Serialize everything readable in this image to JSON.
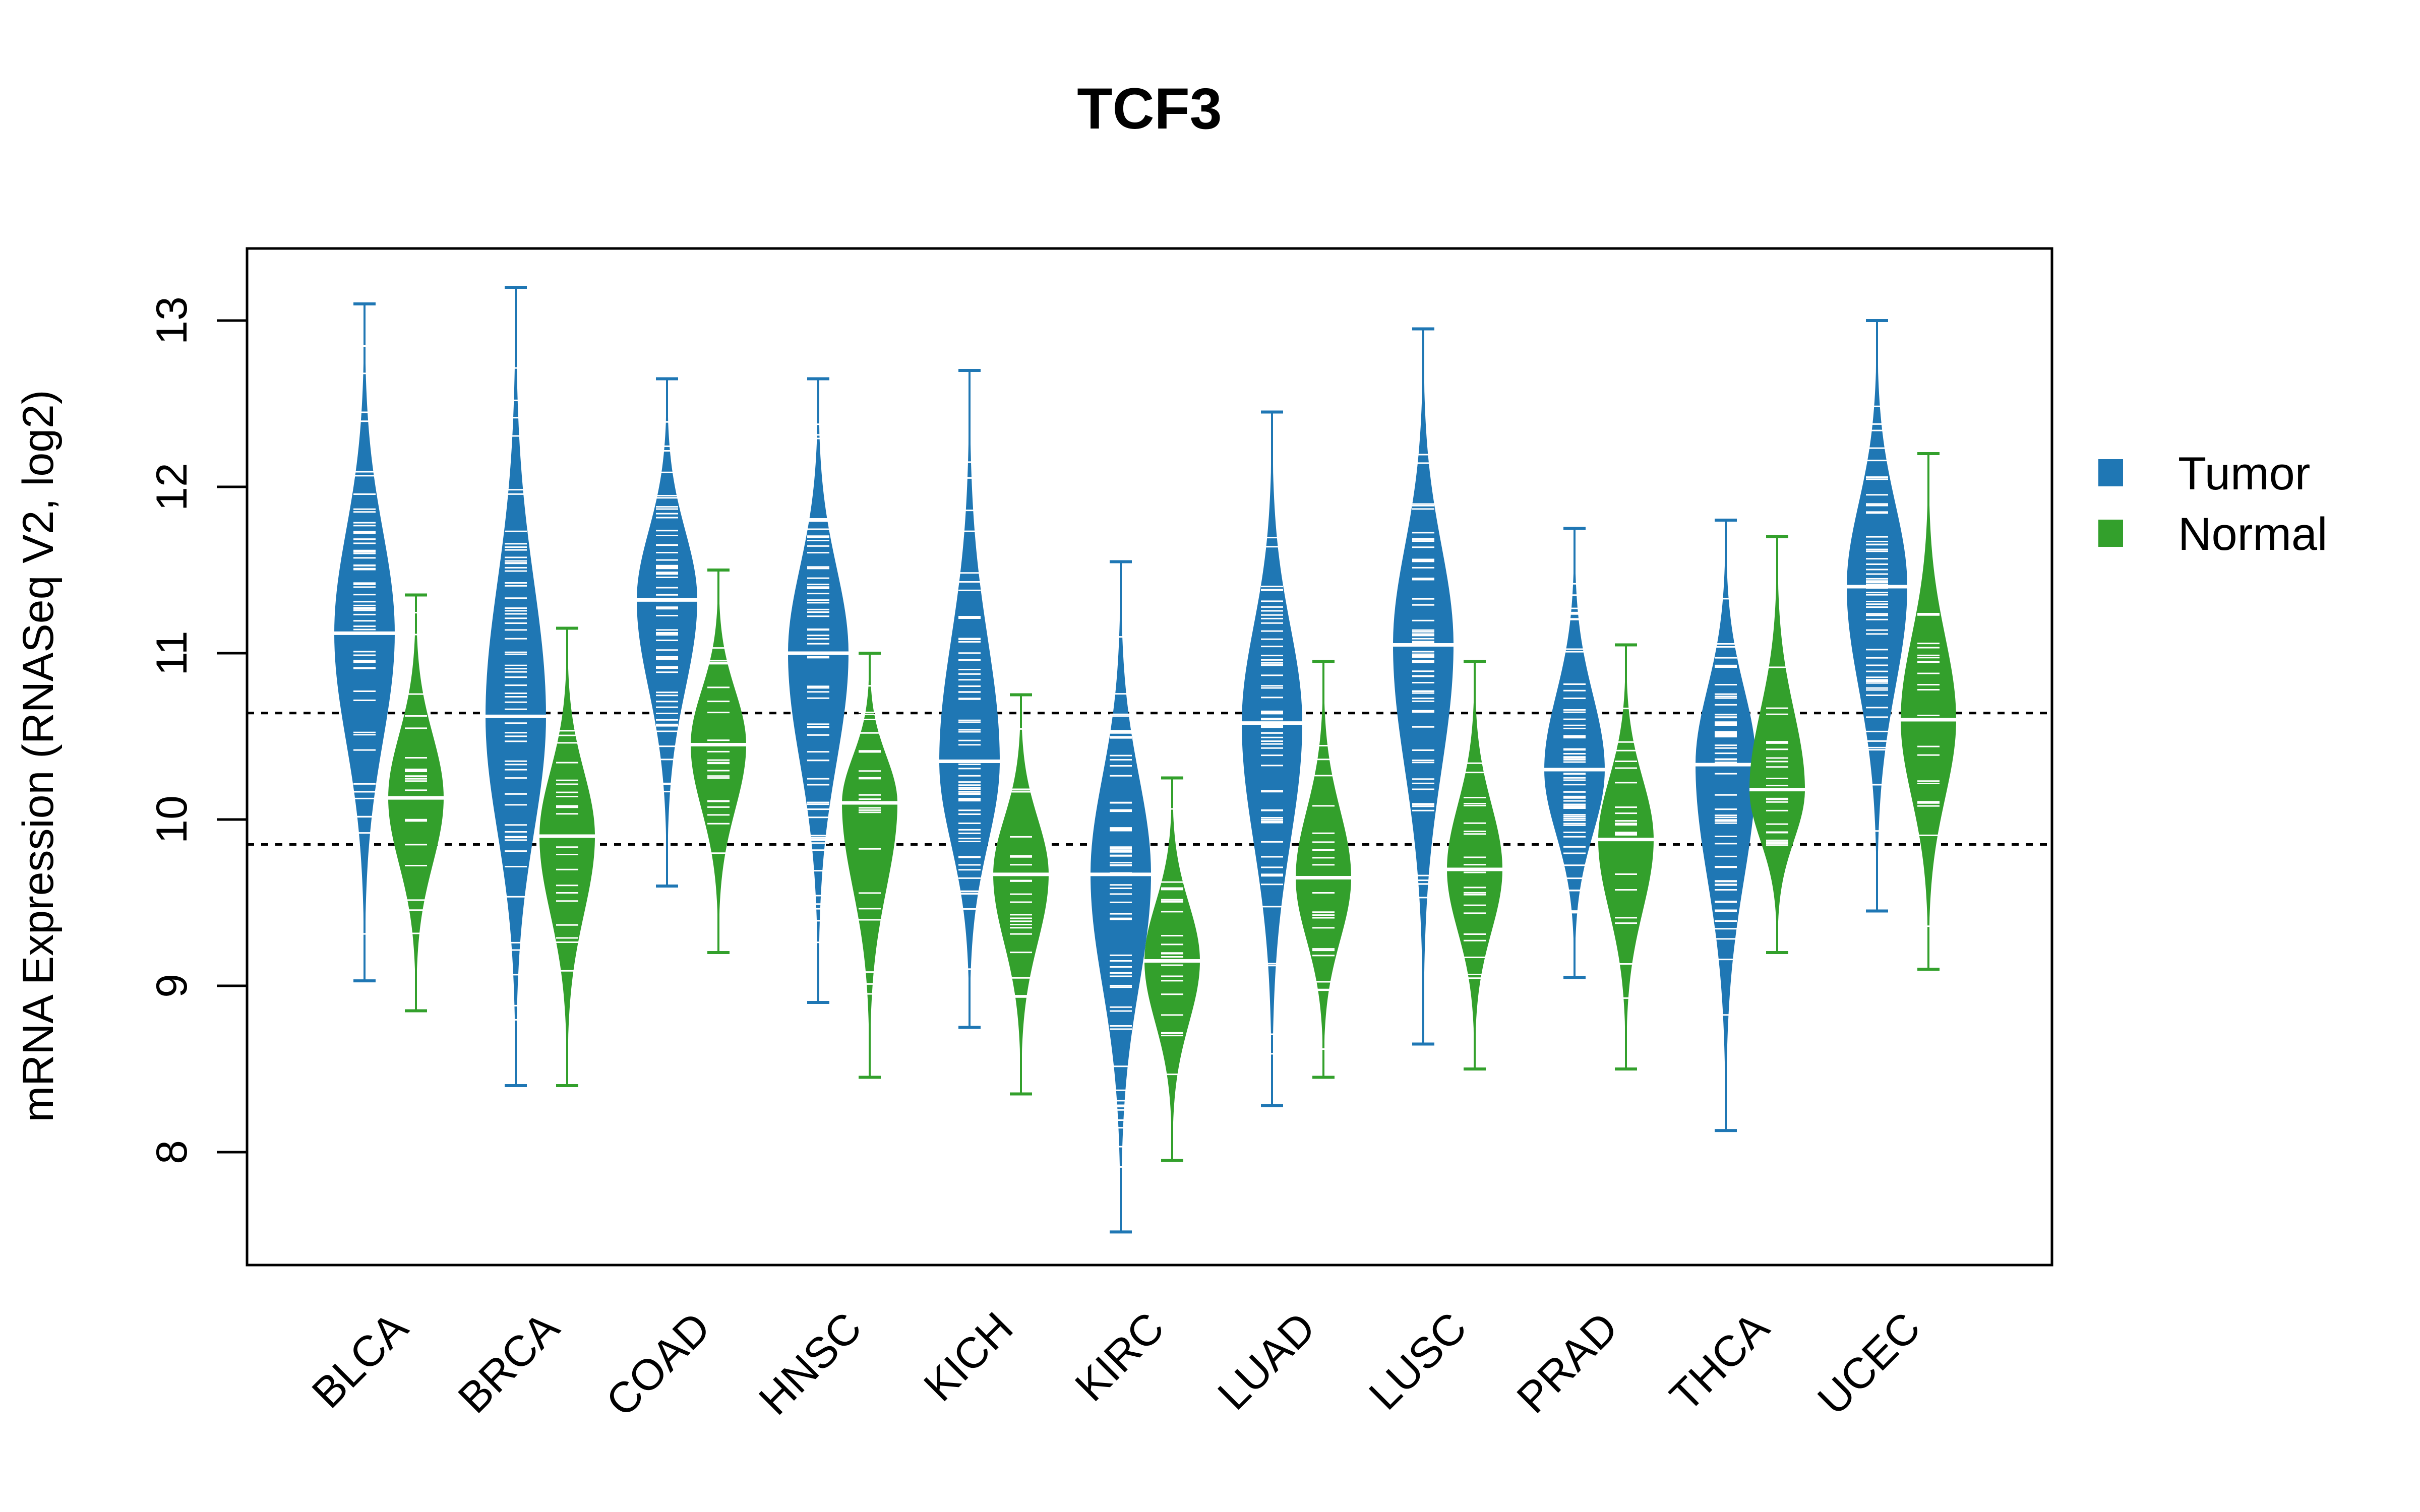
{
  "chart_data": {
    "type": "beanplot",
    "title": "TCF3",
    "xlabel": "",
    "ylabel": "mRNA Expression (RNASeq V2, log2)",
    "ylim": [
      7.4,
      13.5
    ],
    "yticks": [
      8,
      9,
      10,
      11,
      12,
      13
    ],
    "categories": [
      "BLCA",
      "BRCA",
      "COAD",
      "HNSC",
      "KICH",
      "KIRC",
      "LUAD",
      "LUSC",
      "PRAD",
      "THCA",
      "UCEC"
    ],
    "reference_lines": [
      10.64,
      9.85
    ],
    "legend": {
      "position": "right",
      "entries": [
        "Tumor",
        "Normal"
      ]
    },
    "colors": {
      "Tumor": "#1F77B4",
      "Normal": "#33A02C"
    },
    "series": [
      {
        "name": "Tumor",
        "median": [
          11.12,
          10.62,
          11.32,
          11.0,
          10.35,
          9.67,
          10.58,
          11.05,
          10.3,
          10.33,
          11.4
        ],
        "min": [
          9.03,
          8.4,
          9.6,
          8.9,
          8.75,
          7.52,
          8.28,
          8.65,
          9.05,
          8.13,
          9.45
        ],
        "max": [
          13.1,
          13.2,
          12.65,
          12.65,
          12.7,
          11.55,
          12.45,
          12.95,
          11.75,
          11.8,
          13.0
        ]
      },
      {
        "name": "Normal",
        "median": [
          10.13,
          9.9,
          10.45,
          10.1,
          9.67,
          9.15,
          9.65,
          9.7,
          9.88,
          10.18,
          10.6
        ],
        "min": [
          8.85,
          8.4,
          9.2,
          8.45,
          8.35,
          7.95,
          8.45,
          8.5,
          8.5,
          9.2,
          9.1
        ],
        "max": [
          11.35,
          11.15,
          11.5,
          11.0,
          10.75,
          10.25,
          10.95,
          10.95,
          11.05,
          11.7,
          12.2
        ]
      }
    ]
  }
}
